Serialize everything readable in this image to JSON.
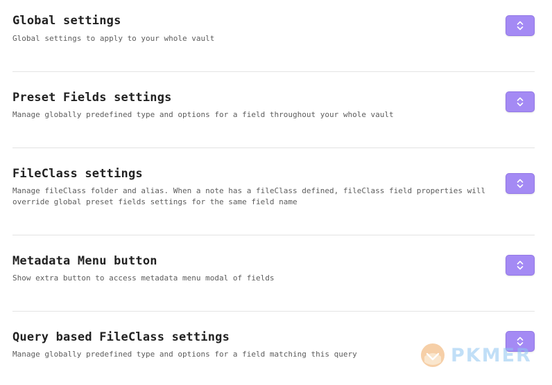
{
  "settings": [
    {
      "title": "Global settings",
      "description": "Global settings to apply to your whole vault",
      "button_icon": "chevrons-up-down-icon"
    },
    {
      "title": "Preset Fields settings",
      "description": "Manage globally predefined type and options for a field throughout your whole vault",
      "button_icon": "chevrons-up-down-icon"
    },
    {
      "title": "FileClass settings",
      "description": "Manage fileClass folder and alias. When a note has a fileClass defined, fileClass field properties will override global preset fields settings for the same field name",
      "button_icon": "chevrons-up-down-icon"
    },
    {
      "title": "Metadata Menu button",
      "description": "Show extra button to access metadata menu modal of fields",
      "button_icon": "chevrons-up-down-icon"
    },
    {
      "title": "Query based FileClass settings",
      "description": "Manage globally predefined type and options for a field matching this query",
      "button_icon": "chevrons-up-down-icon"
    }
  ],
  "watermark": {
    "text": "PKMER",
    "logo_icon": "pkmer-logo-icon"
  },
  "colors": {
    "button_background": "#a48af4",
    "divider": "#e3e3e3",
    "title_text": "#222222",
    "description_text": "#5c5c5c",
    "watermark_text": "#8fc6f2"
  }
}
